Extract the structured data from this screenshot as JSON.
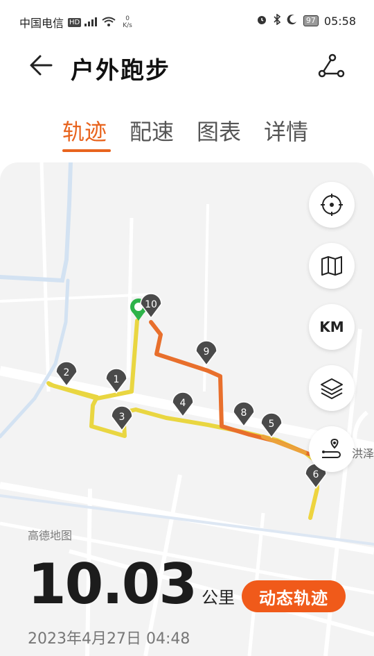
{
  "status_bar": {
    "carrier": "中国电信",
    "hd": "HD",
    "net_speed_value": "0",
    "net_speed_unit": "K/s",
    "battery": "97",
    "time": "05:58"
  },
  "header": {
    "title": "户外跑步"
  },
  "tabs": [
    {
      "label": "轨迹",
      "active": true
    },
    {
      "label": "配速",
      "active": false
    },
    {
      "label": "图表",
      "active": false
    },
    {
      "label": "详情",
      "active": false
    }
  ],
  "map": {
    "provider_label": "高德地图",
    "place_label": "洪泽",
    "km_markers": [
      "1",
      "2",
      "3",
      "4",
      "5",
      "6",
      "8",
      "9",
      "10"
    ],
    "controls": {
      "km_label": "KM"
    }
  },
  "summary": {
    "distance": "10.03",
    "distance_unit": "公里",
    "dynamic_track_label": "动态轨迹",
    "datetime": "2023年4月27日 04:48"
  },
  "colors": {
    "accent": "#e8641e",
    "button": "#f05a1a",
    "track_yellow": "#e9d641",
    "track_orange": "#e86f2c",
    "marker": "#4a4a4a",
    "start_marker": "#2db34a"
  }
}
